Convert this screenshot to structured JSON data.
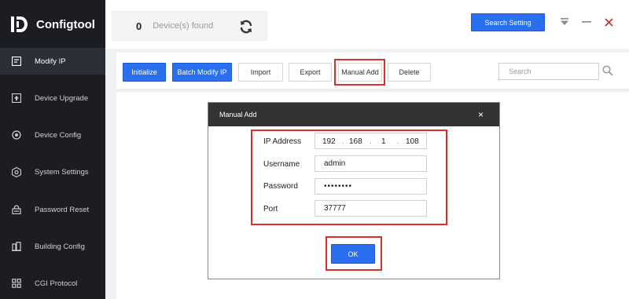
{
  "app": {
    "title": "Configtool",
    "logo_icon": "configtool-logo"
  },
  "sidebar": {
    "items": [
      {
        "label": "Modify IP",
        "icon": "modify-ip-icon",
        "active": true
      },
      {
        "label": "Device Upgrade",
        "icon": "upgrade-icon",
        "active": false
      },
      {
        "label": "Device Config",
        "icon": "config-icon",
        "active": false
      },
      {
        "label": "System Settings",
        "icon": "settings-icon",
        "active": false
      },
      {
        "label": "Password Reset",
        "icon": "lock-icon",
        "active": false
      },
      {
        "label": "Building Config",
        "icon": "building-icon",
        "active": false
      },
      {
        "label": "CGI Protocol",
        "icon": "cgi-icon",
        "active": false
      }
    ]
  },
  "header": {
    "device_count": "0",
    "device_label": "Device(s) found",
    "search_setting_label": "Search Setting"
  },
  "toolbar": {
    "initialize": "Initialize",
    "batch_modify_ip": "Batch Modify IP",
    "import": "Import",
    "export": "Export",
    "manual_add": "Manual Add",
    "delete": "Delete",
    "search_placeholder": "Search"
  },
  "dialog": {
    "title": "Manual Add",
    "close_glyph": "×",
    "ip_label": "IP Address",
    "ip": [
      "192",
      "168",
      "1",
      "108"
    ],
    "ip_separator": ".",
    "username_label": "Username",
    "username": "admin",
    "password_label": "Password",
    "password": "••••••••",
    "port_label": "Port",
    "port": "37777",
    "ok_label": "OK"
  },
  "colors": {
    "accent": "#2a6ff0",
    "highlight": "#d9302c",
    "sidebar_bg": "#1b1d22",
    "dialog_header": "#333333",
    "close_red": "#d9302c"
  }
}
